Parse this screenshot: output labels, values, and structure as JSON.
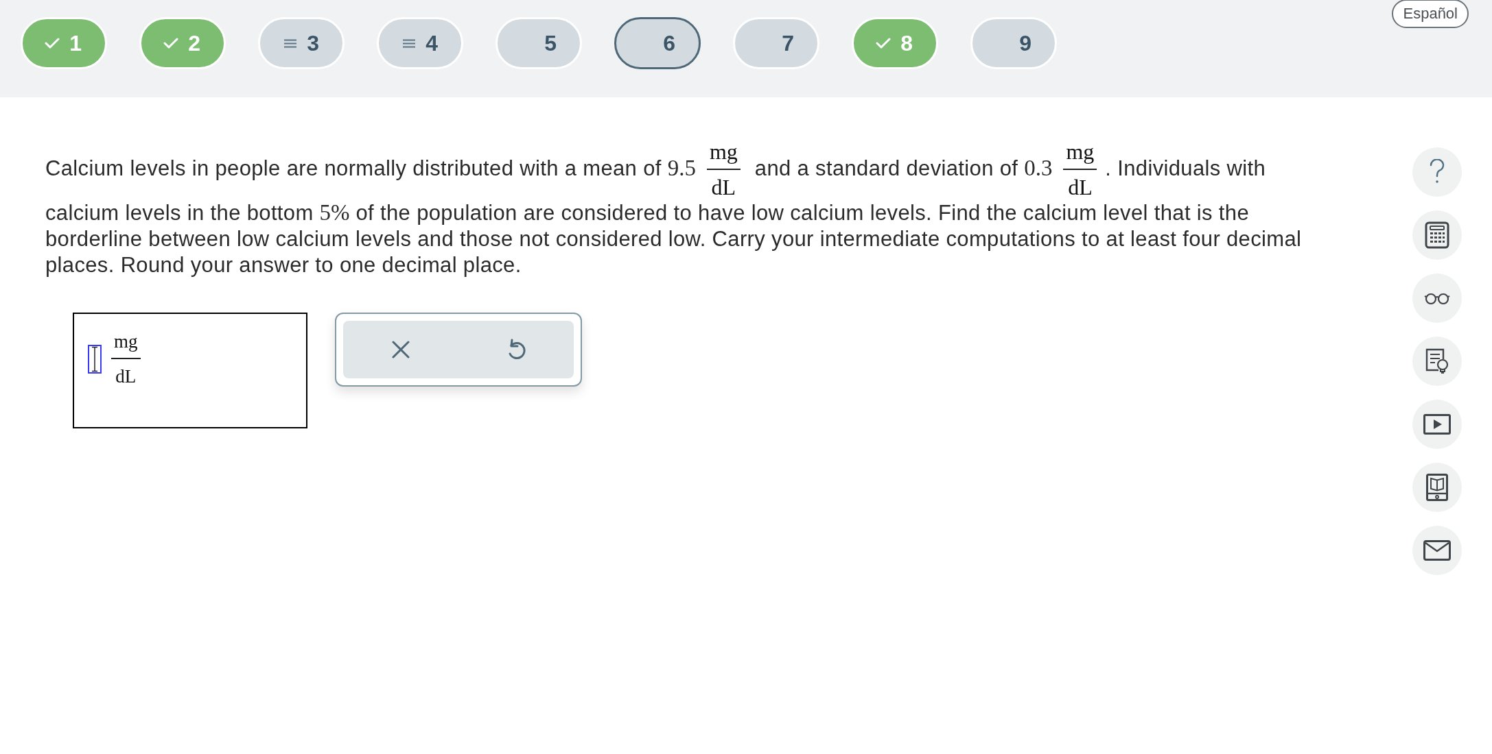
{
  "language_button": {
    "label": "Español"
  },
  "question_nav": [
    {
      "label": "1",
      "kind": "correct",
      "selected": false
    },
    {
      "label": "2",
      "kind": "correct",
      "selected": false
    },
    {
      "label": "3",
      "kind": "attempted",
      "selected": false
    },
    {
      "label": "4",
      "kind": "attempted",
      "selected": false
    },
    {
      "label": "5",
      "kind": "unanswered",
      "selected": false
    },
    {
      "label": "6",
      "kind": "unanswered",
      "selected": true
    },
    {
      "label": "7",
      "kind": "unanswered",
      "selected": false
    },
    {
      "label": "8",
      "kind": "correct",
      "selected": false
    },
    {
      "label": "9",
      "kind": "unanswered",
      "selected": false
    }
  ],
  "question": {
    "segments": [
      {
        "kind": "text",
        "text": "Calcium levels in people are normally distributed with a mean of "
      },
      {
        "kind": "math",
        "text": "9.5"
      },
      {
        "kind": "fraction",
        "numerator": "mg",
        "denominator": "dL"
      },
      {
        "kind": "text",
        "text": " and a standard deviation of "
      },
      {
        "kind": "math",
        "text": "0.3"
      },
      {
        "kind": "fraction",
        "numerator": "mg",
        "denominator": "dL"
      },
      {
        "kind": "text",
        "text": ". Individuals with calcium levels in the bottom "
      },
      {
        "kind": "math",
        "text": "5%"
      },
      {
        "kind": "text",
        "text": " of the population are considered to have low calcium levels. Find the calcium level that is the borderline between low calcium levels and those not considered low. Carry your intermediate computations to at least four decimal places. Round your answer to one decimal place."
      }
    ]
  },
  "answer": {
    "unit": {
      "numerator": "mg",
      "denominator": "dL"
    },
    "tools": [
      {
        "kind": "clear"
      },
      {
        "kind": "undo"
      }
    ]
  },
  "sidebar": {
    "tools": [
      {
        "kind": "help"
      },
      {
        "kind": "calculator"
      },
      {
        "kind": "glasses"
      },
      {
        "kind": "hint"
      },
      {
        "kind": "video"
      },
      {
        "kind": "ebook"
      },
      {
        "kind": "mail"
      }
    ]
  }
}
